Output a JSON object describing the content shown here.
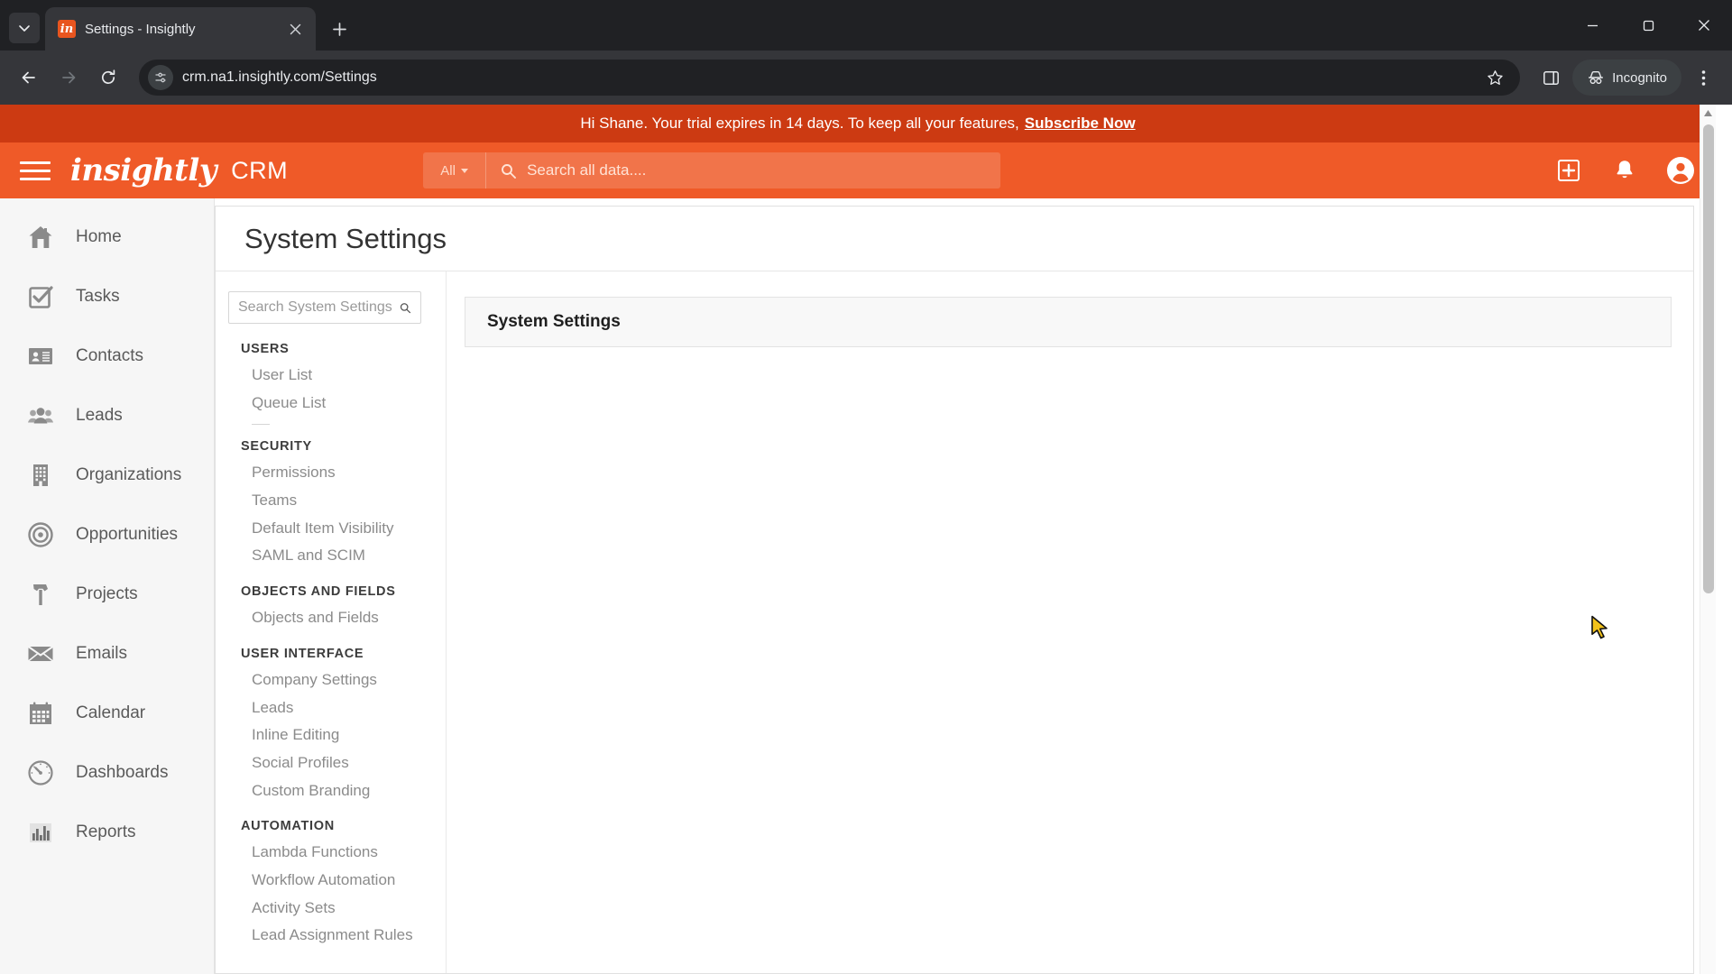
{
  "browser": {
    "tab": {
      "title": "Settings - Insightly",
      "favicon_label": "in",
      "favicon_color": "#e8551f"
    },
    "tab_search_icon": "chevron-down-icon",
    "new_tab_icon": "plus-icon",
    "close_tab_icon": "close-icon",
    "nav": {
      "back_icon": "back-arrow-icon",
      "forward_icon": "forward-arrow-icon",
      "reload_icon": "reload-icon"
    },
    "omnibox": {
      "url": "crm.na1.insightly.com/Settings",
      "site_info_icon": "site-settings-icon",
      "star_icon": "bookmark-star-icon"
    },
    "side_panel_icon": "side-panel-icon",
    "incognito": {
      "label": "Incognito",
      "icon": "incognito-hat-icon"
    },
    "menu_icon": "three-dot-menu-icon",
    "window": {
      "minimize": "minimize-icon",
      "maximize": "maximize-icon",
      "close": "window-close-icon"
    }
  },
  "banner": {
    "text": "Hi Shane. Your trial expires in 14 days. To keep all your features,",
    "link": "Subscribe Now",
    "background": "#cc3a12"
  },
  "header": {
    "menu_icon": "hamburger-menu-icon",
    "brand": "insightly",
    "app_name": "CRM",
    "accent": "#ef5a28",
    "search": {
      "scope": "All",
      "placeholder": "Search all data....",
      "icon": "search-icon"
    },
    "actions": [
      {
        "name": "add-button",
        "icon": "plus-square-icon"
      },
      {
        "name": "notifications-button",
        "icon": "bell-icon"
      },
      {
        "name": "profile-button",
        "icon": "user-avatar-icon"
      }
    ]
  },
  "sidebar": {
    "items": [
      {
        "label": "Home",
        "icon": "home-icon"
      },
      {
        "label": "Tasks",
        "icon": "checkbox-task-icon"
      },
      {
        "label": "Contacts",
        "icon": "contact-card-icon"
      },
      {
        "label": "Leads",
        "icon": "people-group-icon"
      },
      {
        "label": "Organizations",
        "icon": "building-icon"
      },
      {
        "label": "Opportunities",
        "icon": "target-icon"
      },
      {
        "label": "Projects",
        "icon": "hammer-icon"
      },
      {
        "label": "Emails",
        "icon": "envelope-icon"
      },
      {
        "label": "Calendar",
        "icon": "calendar-icon"
      },
      {
        "label": "Dashboards",
        "icon": "gauge-icon"
      },
      {
        "label": "Reports",
        "icon": "bar-chart-icon"
      }
    ]
  },
  "page": {
    "title": "System Settings",
    "settings_search": {
      "placeholder": "Search System Settings",
      "value": "",
      "icon": "search-icon"
    },
    "groups": [
      {
        "title": "USERS",
        "items": [
          "User List",
          "Queue List"
        ],
        "divider_after": true
      },
      {
        "title": "SECURITY",
        "items": [
          "Permissions",
          "Teams",
          "Default Item Visibility",
          "SAML and SCIM"
        ],
        "divider_after": false
      },
      {
        "title": "OBJECTS AND FIELDS",
        "items": [
          "Objects and Fields"
        ],
        "divider_after": false
      },
      {
        "title": "USER INTERFACE",
        "items": [
          "Company Settings",
          "Leads",
          "Inline Editing",
          "Social Profiles",
          "Custom Branding"
        ],
        "divider_after": false
      },
      {
        "title": "AUTOMATION",
        "items": [
          "Lambda Functions",
          "Workflow Automation",
          "Activity Sets",
          "Lead Assignment Rules"
        ],
        "divider_after": false
      }
    ],
    "panel_title": "System Settings"
  }
}
